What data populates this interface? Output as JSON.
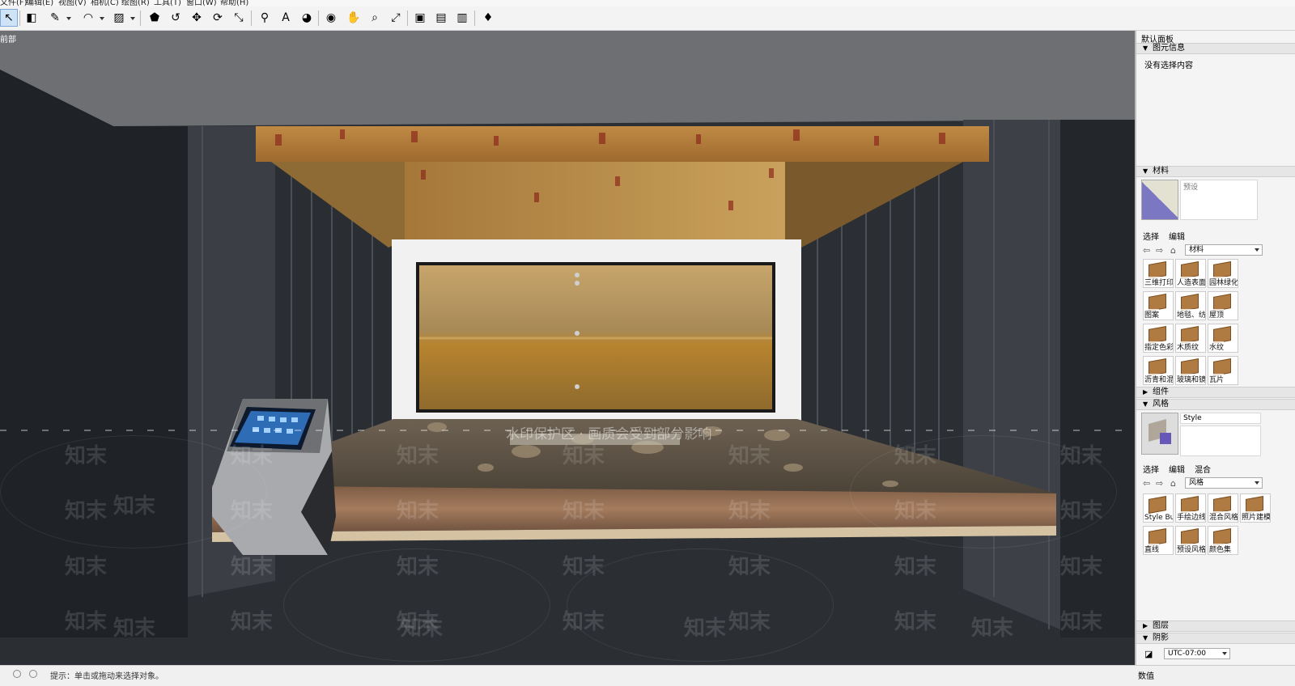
{
  "menu": [
    "文件(F)",
    "编辑(E)",
    "视图(V)",
    "相机(C)",
    "绘图(R)",
    "工具(T)",
    "窗口(W)",
    "帮助(H)"
  ],
  "toolbar": {
    "tools": [
      {
        "name": "select-tool",
        "glyph": "↖",
        "selected": true
      },
      {
        "name": "eraser-tool",
        "glyph": "◧"
      },
      {
        "name": "pencil-tool",
        "glyph": "✎",
        "dropdown": true
      },
      {
        "name": "arc-tool",
        "glyph": "◠",
        "dropdown": true
      },
      {
        "name": "rectangle-tool",
        "glyph": "▨",
        "dropdown": true
      },
      {
        "name": "push-pull-tool",
        "glyph": "⬟"
      },
      {
        "name": "offset-tool",
        "glyph": "↺"
      },
      {
        "name": "move-tool",
        "glyph": "✥"
      },
      {
        "name": "rotate-tool",
        "glyph": "⟳"
      },
      {
        "name": "scale-tool",
        "glyph": "⤡"
      },
      {
        "name": "tape-measure-tool",
        "glyph": "⚲"
      },
      {
        "name": "text-tool",
        "glyph": "A"
      },
      {
        "name": "paint-bucket-tool",
        "glyph": "◕"
      },
      {
        "name": "orbit-tool",
        "glyph": "◉"
      },
      {
        "name": "pan-tool",
        "glyph": "✋"
      },
      {
        "name": "zoom-tool",
        "glyph": "⌕"
      },
      {
        "name": "zoom-extents-tool",
        "glyph": "⤢"
      },
      {
        "name": "warehouse-tool",
        "glyph": "▣"
      },
      {
        "name": "extension-warehouse-tool",
        "glyph": "▤"
      },
      {
        "name": "share-model-tool",
        "glyph": "▥"
      },
      {
        "name": "ruby-console-tool",
        "glyph": "♦"
      }
    ]
  },
  "viewport": {
    "scene_label": "前部",
    "banner_text": "水印保护区 · 画质会受到部分影响",
    "watermark": "知末",
    "colors": {
      "sky": "#6c6e71",
      "floor": "#24272b",
      "wall": "#3d4148",
      "ceiling": "#b8863f",
      "pit": "#6e5f4c",
      "kiosk": "#a9aaad"
    }
  },
  "status": {
    "text": "提示：单击或拖动来选择对象。"
  },
  "tray": {
    "title": "默认面板",
    "entity_info": {
      "header": "图元信息",
      "content": "没有选择内容"
    },
    "materials": {
      "header": "材料",
      "preset_label": "预设",
      "tabs": [
        "选择",
        "编辑"
      ],
      "combo": "材料",
      "items": [
        "三维打印",
        "人造表面",
        "园林绿化",
        "图案",
        "地毯、纺织",
        "屋顶",
        "指定色彩",
        "木质纹",
        "水纹",
        "沥青和混",
        "玻璃和镜",
        "瓦片"
      ]
    },
    "components": {
      "header": "组件"
    },
    "styles": {
      "header": "风格",
      "style_name": "Style",
      "tabs": [
        "选择",
        "编辑",
        "混合"
      ],
      "combo": "风格",
      "items": [
        "Style Buil",
        "手绘边线",
        "混合风格",
        "照片建模",
        "直线",
        "预设风格",
        "颜色集"
      ]
    },
    "layers": {
      "header": "图层"
    },
    "shadows": {
      "header": "阴影",
      "timezone": "UTC-07:00"
    }
  },
  "status_right": "数值"
}
